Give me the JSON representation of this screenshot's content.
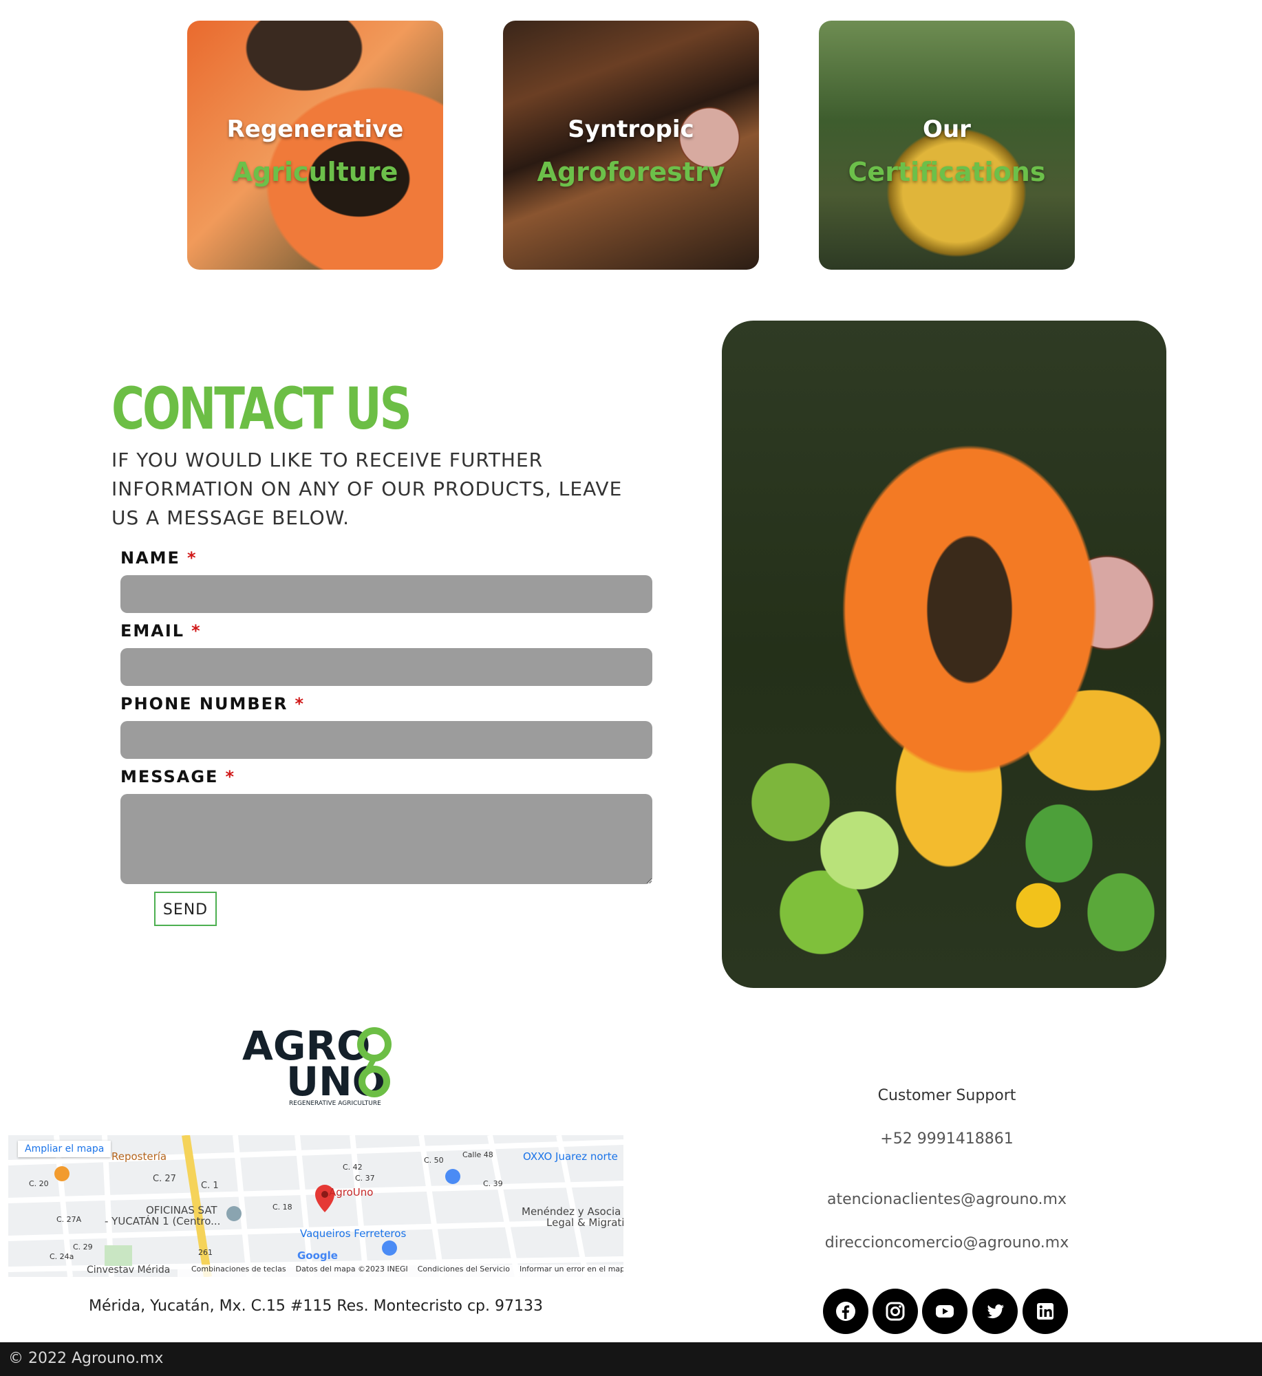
{
  "cards": [
    {
      "line1": "Regenerative",
      "line2": "Agriculture"
    },
    {
      "line1": "Syntropic",
      "line2": "Agroforestry"
    },
    {
      "line1": "Our",
      "line2": "Certifications"
    }
  ],
  "contact": {
    "title": "CONTACT US",
    "subtitle": "IF YOU WOULD LIKE TO RECEIVE FURTHER INFORMATION ON ANY OF OUR PRODUCTS, LEAVE US A MESSAGE BELOW.",
    "fields": [
      {
        "label": "NAME",
        "required_mark": "*",
        "value": ""
      },
      {
        "label": "EMAIL",
        "required_mark": "*",
        "value": ""
      },
      {
        "label": "PHONE NUMBER",
        "required_mark": "*",
        "value": ""
      },
      {
        "label": "MESSAGE",
        "required_mark": "*",
        "value": ""
      }
    ],
    "send_label": "SEND"
  },
  "logo": {
    "line1": "AGRO",
    "line2": "UNO",
    "tagline": "REGENERATIVE AGRICULTURE"
  },
  "map": {
    "expand_link": "Ampliar el mapa",
    "labels": [
      "Repostería",
      "C. 27",
      "C. 1",
      "OFICINAS SAT",
      "- YUCATÁN 1 (Centro...",
      "AgroUno",
      "Vaqueiros Ferreteros",
      "OXXO Juarez norte",
      "Menéndez y Asocia",
      "Legal & Migrati",
      "C. 37",
      "C. 39",
      "C. 50",
      "Calle 48",
      "C. 42",
      "C. 18",
      "C. 29",
      "C. 27A",
      "C. 20",
      "C. 24a",
      "Cinvestav Mérida",
      "261"
    ],
    "footer_items": [
      "Combinaciones de teclas",
      "Datos del mapa ©2023 INEGI",
      "Condiciones del Servicio",
      "Informar un error en el mapa"
    ],
    "google": "Google"
  },
  "address": "Mérida, Yucatán, Mx. C.15 #115 Res. Montecristo cp. 97133",
  "support": {
    "title": "Customer Support",
    "phone": "+52 9991418861",
    "email_1": "atencionaclientes@agrouno.mx",
    "email_2": "direccioncomercio@agrouno.mx"
  },
  "social_icons": [
    "facebook-icon",
    "instagram-icon",
    "youtube-icon",
    "twitter-icon",
    "linkedin-icon"
  ],
  "footer": {
    "copyright": "© 2022 Agrouno.mx"
  },
  "colors": {
    "accent_green": "#6cbe45",
    "required_red": "#d01818",
    "field_gray": "#9c9c9c",
    "footer_bg": "#151515"
  }
}
